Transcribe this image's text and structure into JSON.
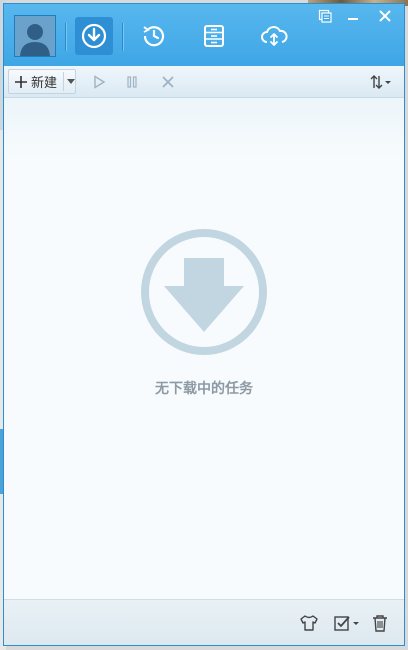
{
  "window": {
    "controls": [
      "skin-icon",
      "minimize-icon",
      "close-icon"
    ]
  },
  "nav": {
    "tabs": [
      {
        "name": "downloading",
        "icon": "download-icon",
        "active": true
      },
      {
        "name": "history",
        "icon": "clock-icon",
        "active": false
      },
      {
        "name": "completed",
        "icon": "file-cabinet-icon",
        "active": false
      },
      {
        "name": "cloud",
        "icon": "cloud-sync-icon",
        "active": false
      }
    ]
  },
  "toolbar": {
    "new_label": "新建",
    "buttons": [
      "start-icon",
      "pause-icon",
      "delete-icon"
    ],
    "sort_icon": "sort-icon"
  },
  "main": {
    "empty_message": "无下载中的任务"
  },
  "statusbar": {
    "icons": [
      "shirt-skin-icon",
      "checkbox-icon",
      "trash-icon"
    ]
  },
  "colors": {
    "titlebar": "#45aae9",
    "accent_border": "#2a8fd0",
    "empty_graphic": "#c2d6e1",
    "empty_text": "#8d9aa4"
  }
}
